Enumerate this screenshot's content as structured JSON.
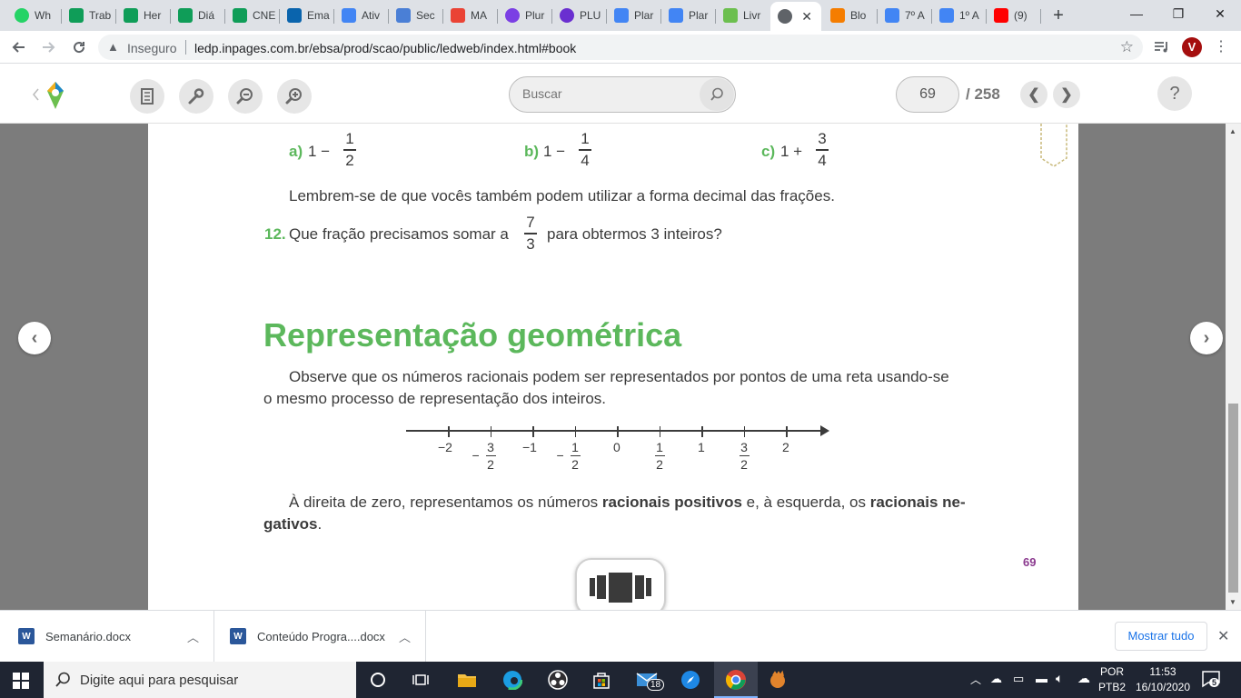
{
  "browser": {
    "tabs": [
      {
        "label": "Wh",
        "icon": "whatsapp-icon",
        "color": "#25d366"
      },
      {
        "label": "Trab",
        "icon": "sheets-icon",
        "color": "#0f9d58"
      },
      {
        "label": "Her",
        "icon": "sheets-icon",
        "color": "#0f9d58"
      },
      {
        "label": "Diá",
        "icon": "sheets-icon",
        "color": "#0f9d58"
      },
      {
        "label": "CNE",
        "icon": "sheets-icon",
        "color": "#0f9d58"
      },
      {
        "label": "Ema",
        "icon": "outlook-icon",
        "color": "#0a64ad"
      },
      {
        "label": "Ativ",
        "icon": "docs-icon",
        "color": "#4285f4"
      },
      {
        "label": "Sec",
        "icon": "sec-icon",
        "color": "#4a7fd6"
      },
      {
        "label": "MA",
        "icon": "gmail-icon",
        "color": "#ea4335"
      },
      {
        "label": "Plur",
        "icon": "plurall-icon",
        "color": "#7b3fe4"
      },
      {
        "label": "PLU",
        "icon": "plurall-icon",
        "color": "#6a2fd0"
      },
      {
        "label": "Plar",
        "icon": "docs-icon",
        "color": "#4285f4"
      },
      {
        "label": "Plar",
        "icon": "docs-icon",
        "color": "#4285f4"
      },
      {
        "label": "Livr",
        "icon": "ledweb-icon",
        "color": "#6cbf4f"
      },
      {
        "label": "",
        "icon": "globe-icon",
        "color": "#5f6368",
        "active": true
      },
      {
        "label": "Blo",
        "icon": "blogger-icon",
        "color": "#f57d00"
      },
      {
        "label": "7º A",
        "icon": "docs-icon",
        "color": "#4285f4"
      },
      {
        "label": "1º A",
        "icon": "docs-icon",
        "color": "#4285f4"
      },
      {
        "label": "(9)",
        "icon": "youtube-icon",
        "color": "#ff0000"
      }
    ],
    "new_tab_symbol": "+",
    "window": {
      "minimize": "—",
      "maximize": "❐",
      "close": "✕"
    },
    "address": {
      "security_label": "Inseguro",
      "url": "ledp.inpages.com.br/ebsa/prod/scao/public/ledweb/index.html#book"
    },
    "profile_initial": "V"
  },
  "reader": {
    "search_placeholder": "Buscar",
    "current_page": "69",
    "total_pages": "/ 258",
    "help_label": "?"
  },
  "book_page": {
    "options": [
      {
        "label": "a)",
        "expr": "1 −",
        "num": "1",
        "den": "2"
      },
      {
        "label": "b)",
        "expr": "1 −",
        "num": "1",
        "den": "4"
      },
      {
        "label": "c)",
        "expr": "1 +",
        "num": "3",
        "den": "4"
      }
    ],
    "reminder": "Lembrem-se de que vocês também podem utilizar a forma decimal das frações.",
    "q12": {
      "number": "12.",
      "text_before": "Que fração precisamos somar a",
      "num": "7",
      "den": "3",
      "text_after": "para obtermos 3 inteiros?"
    },
    "section_title": "Representação geométrica",
    "intro_line1": "Observe que os números racionais podem ser representados por pontos de uma reta usando-se",
    "intro_line2": "o mesmo processo de representação dos inteiros.",
    "number_line": {
      "labels": [
        "−2",
        "−1",
        "0",
        "1",
        "2"
      ],
      "fraction_labels": [
        {
          "sign": "−",
          "num": "3",
          "den": "2"
        },
        {
          "sign": "−",
          "num": "1",
          "den": "2"
        },
        {
          "sign": "",
          "num": "1",
          "den": "2"
        },
        {
          "sign": "",
          "num": "3",
          "den": "2"
        }
      ]
    },
    "closing_line1_a": "À direita de zero, representamos os números",
    "closing_bold1": "racionais positivos",
    "closing_line1_b": "e, à esquerda, os",
    "closing_bold2": "racionais ne-",
    "closing_bold3": "gativos",
    "closing_end": ".",
    "page_number": "69"
  },
  "downloads": {
    "items": [
      {
        "name": "Semanário.docx"
      },
      {
        "name": "Conteúdo Progra....docx"
      }
    ],
    "show_all": "Mostrar tudo"
  },
  "taskbar": {
    "search_placeholder": "Digite aqui para pesquisar",
    "mail_badge": "18",
    "lang": "POR",
    "lang_sub": "PTB2",
    "time": "11:53",
    "date": "16/10/2020",
    "notifications": "5"
  }
}
